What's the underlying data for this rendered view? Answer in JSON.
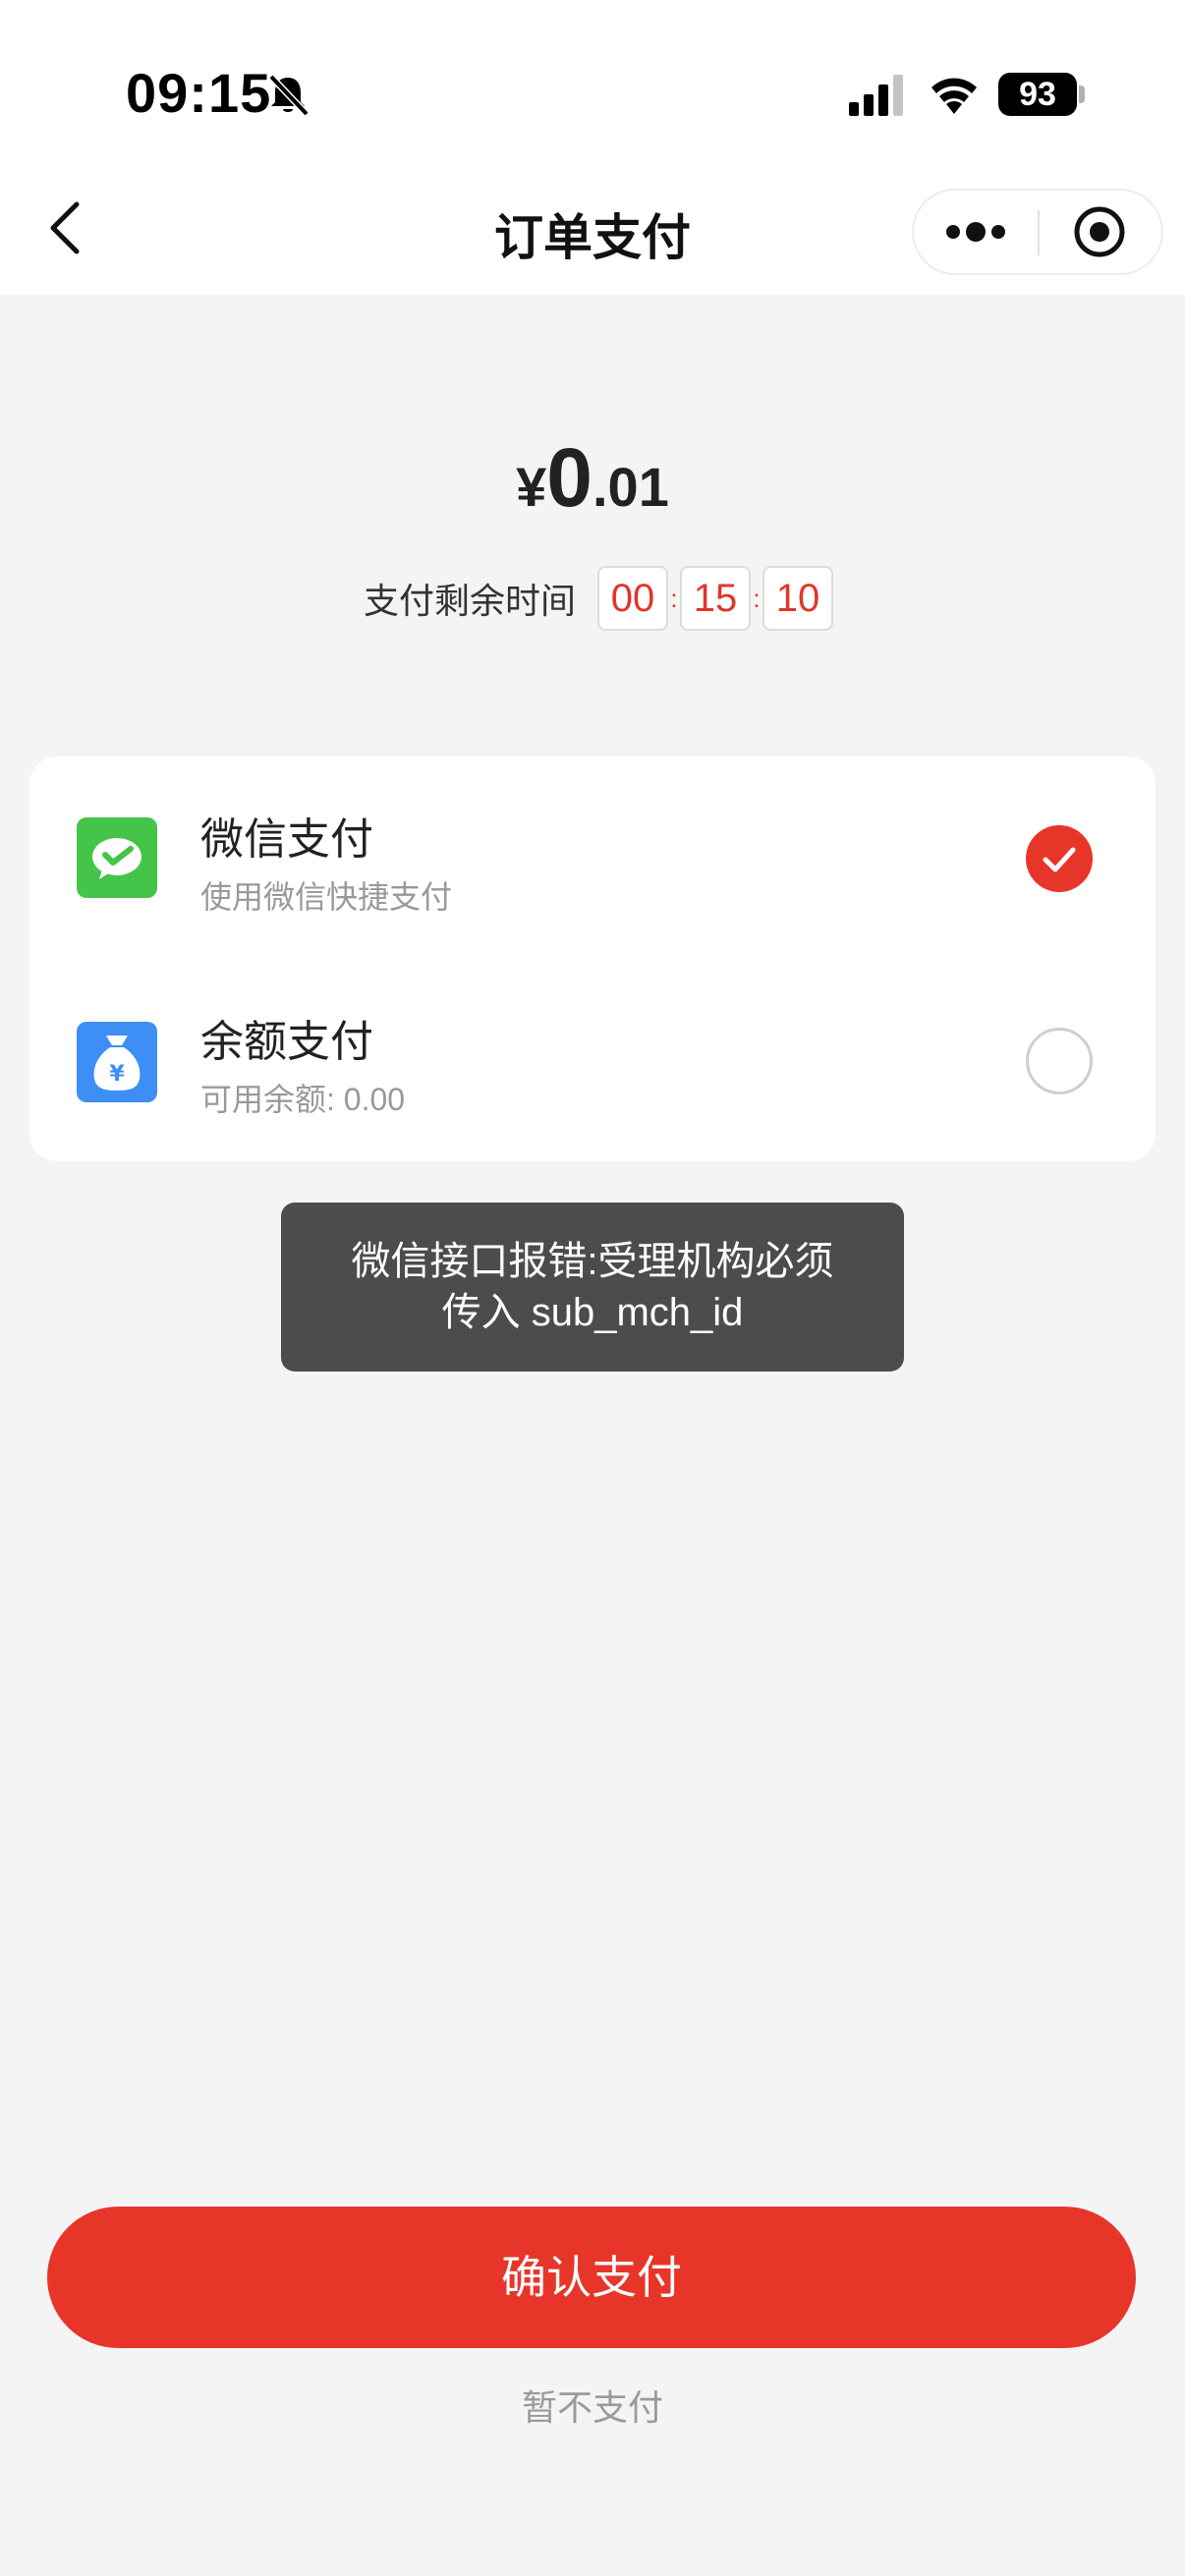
{
  "status_bar": {
    "time": "09:15",
    "battery": "93",
    "icons": [
      "bell-slash-icon",
      "cellular-signal-icon",
      "wifi-icon",
      "battery-icon"
    ]
  },
  "nav": {
    "title": "订单支付",
    "icons": [
      "chevron-left-icon",
      "more-dots-icon",
      "target-close-icon"
    ]
  },
  "amount": {
    "currency": "¥",
    "integer": "0",
    "decimal": ".01"
  },
  "timer": {
    "label": "支付剩余时间",
    "hours": "00",
    "minutes": "15",
    "seconds": "10"
  },
  "payment_methods": [
    {
      "name": "微信支付",
      "description": "使用微信快捷支付",
      "icon": "wechat-pay-icon",
      "selected": true
    },
    {
      "name": "余额支付",
      "description": "可用余额: 0.00",
      "icon": "money-bag-icon",
      "selected": false
    }
  ],
  "toast": {
    "line1": "微信接口报错:受理机构必须",
    "line2": "传入 sub_mch_id"
  },
  "actions": {
    "confirm_label": "确认支付",
    "skip_label": "暂不支付"
  },
  "colors": {
    "accent": "#e8352a",
    "wechat_green": "#45c44a",
    "balance_blue": "#3d8ff5",
    "toast_bg": "#4c4c4c",
    "background": "#f4f4f4"
  }
}
